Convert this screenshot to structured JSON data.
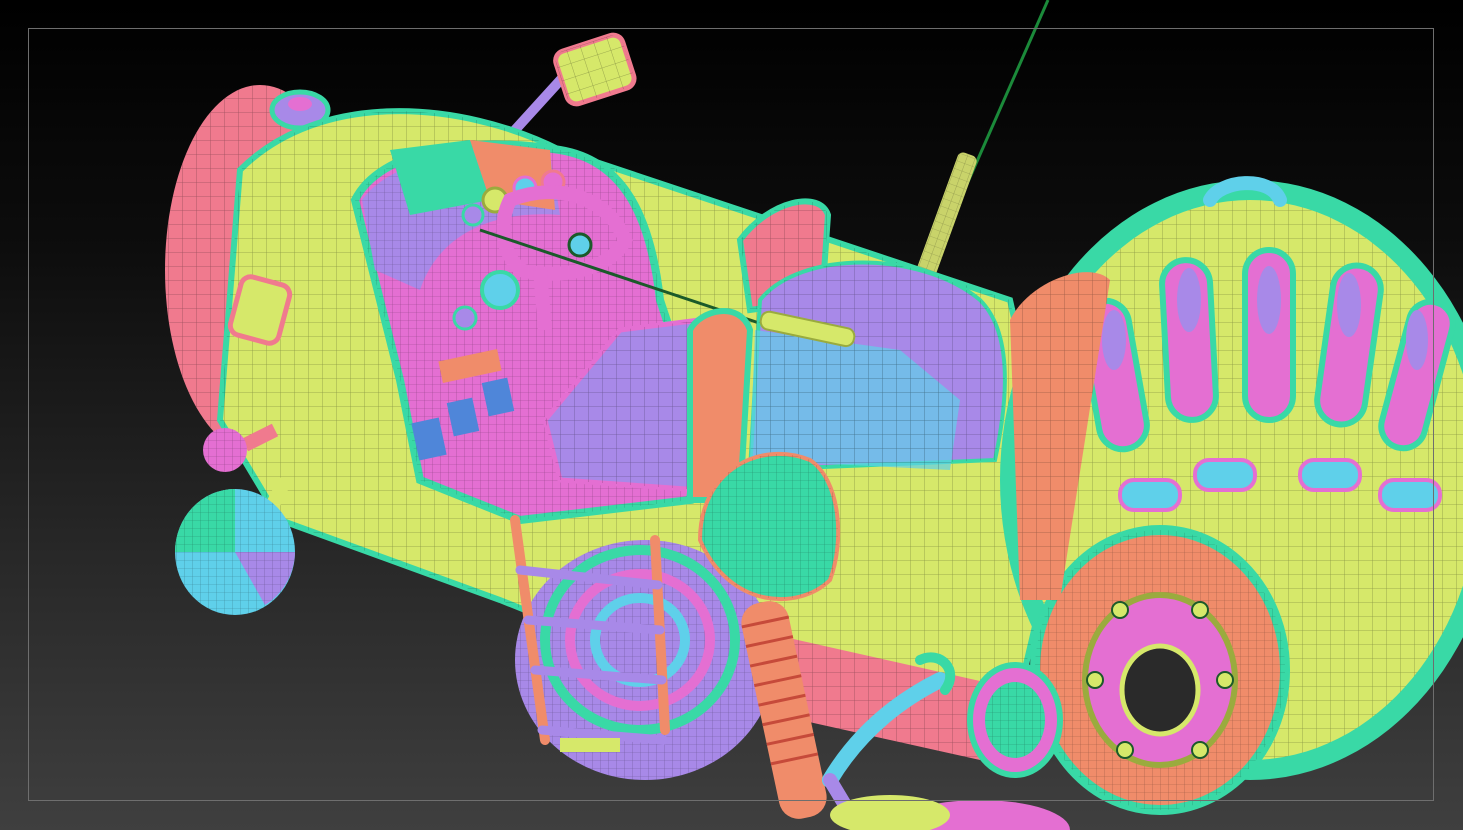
{
  "viewport": {
    "background_top": "#000000",
    "background_bottom": "#3f3f3f",
    "frame_color": "#6e6e6e"
  },
  "palette": {
    "yellow_green": "#d6e86a",
    "pink": "#f07a8e",
    "magenta": "#e46fd2",
    "purple": "#a889e8",
    "teal": "#39d9a6",
    "cyan": "#5fd0ea",
    "blue": "#4f86d9",
    "salmon": "#f08c6a",
    "olive_dark": "#9aab3e",
    "wire": "#1b5a2a"
  },
  "icons": {
    "model": "hover-vehicle-model-icon",
    "antenna": "antenna-icon",
    "mirror": "side-mirror-icon",
    "seat": "seat-icon",
    "steering": "steering-wheel-icon",
    "engine": "turbine-engine-icon",
    "wheel": "wheel-icon",
    "ladder": "ladder-icon",
    "shock": "shock-absorber-icon",
    "headlight": "headlight-icon"
  }
}
